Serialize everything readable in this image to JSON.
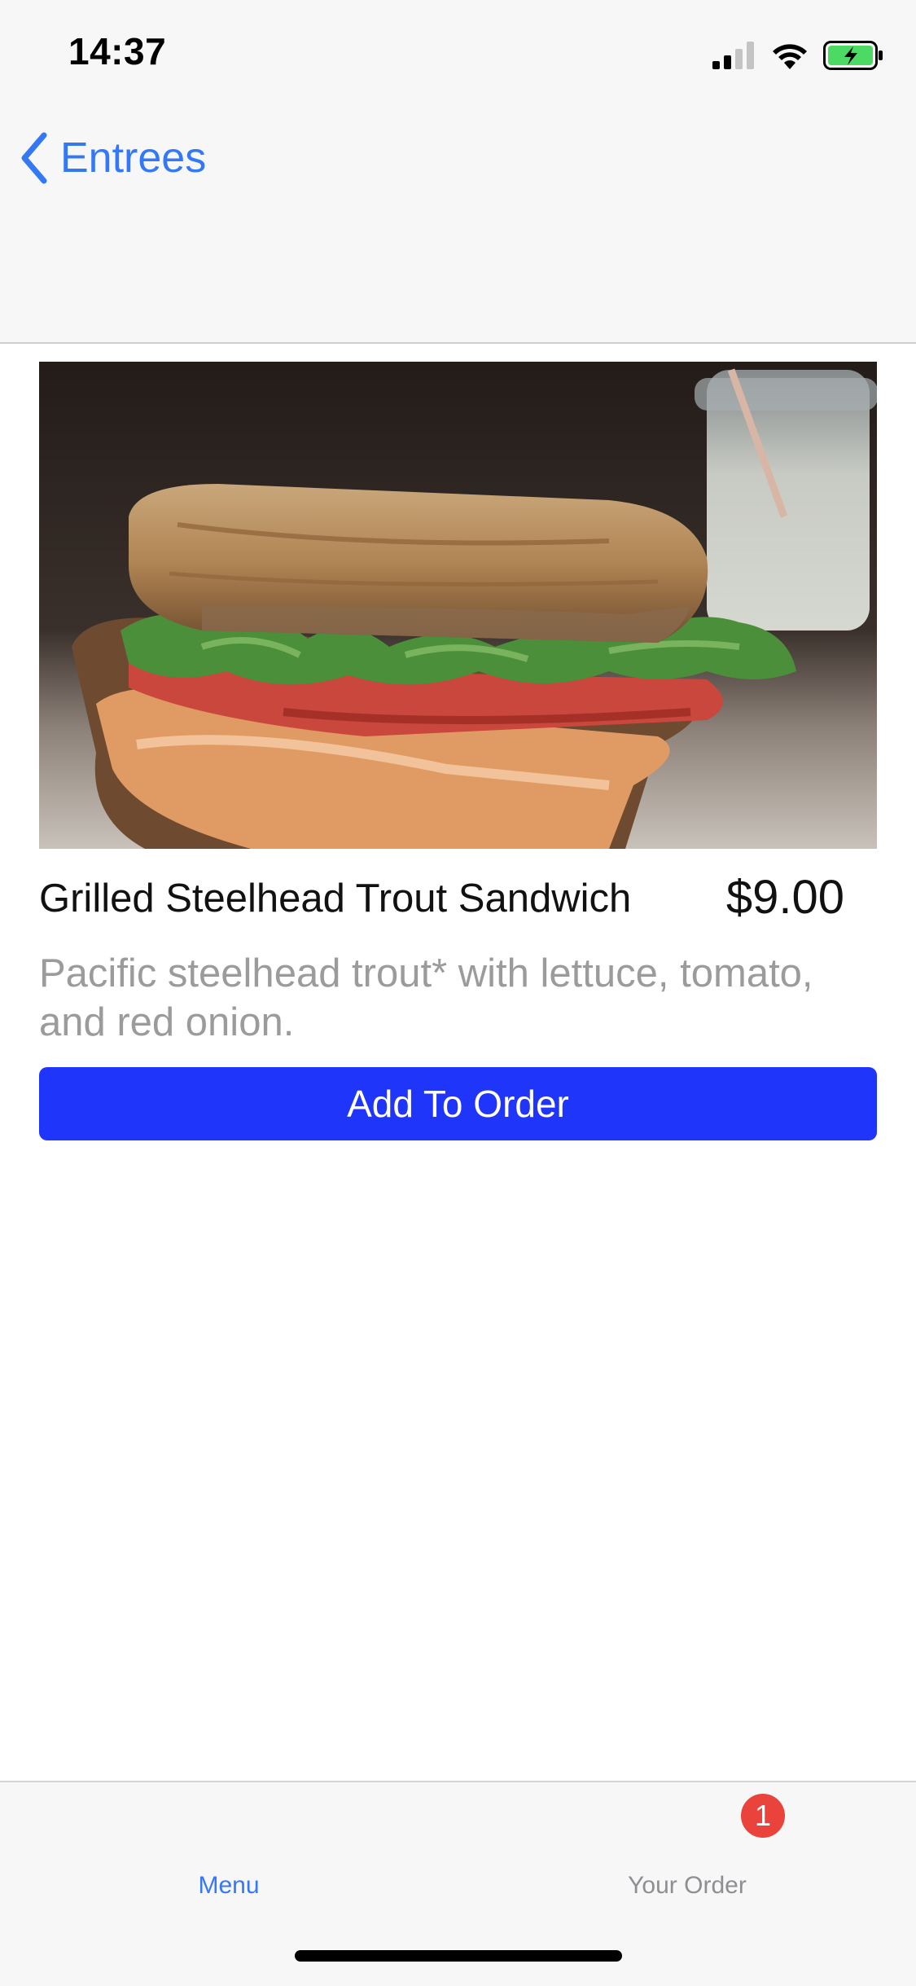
{
  "status_bar": {
    "time": "14:37",
    "icons": [
      "cellular-signal-icon",
      "wifi-icon",
      "battery-charging-icon"
    ]
  },
  "nav": {
    "back_label": "Entrees",
    "back_icon": "chevron-left-icon"
  },
  "item": {
    "image": "sandwich-photo",
    "title": "Grilled Steelhead Trout Sandwich",
    "price": "$9.00",
    "description": "Pacific steelhead trout* with lettuce, tomato, and red onion.",
    "add_button_label": "Add To Order"
  },
  "tab_bar": {
    "tabs": [
      {
        "label": "Menu",
        "selected": true
      },
      {
        "label": "Your Order",
        "selected": false,
        "badge": "1"
      }
    ]
  },
  "colors": {
    "accent": "#3478f6",
    "button": "#1f35fa",
    "badge": "#e9433b",
    "description_text": "#9b9b9b"
  }
}
